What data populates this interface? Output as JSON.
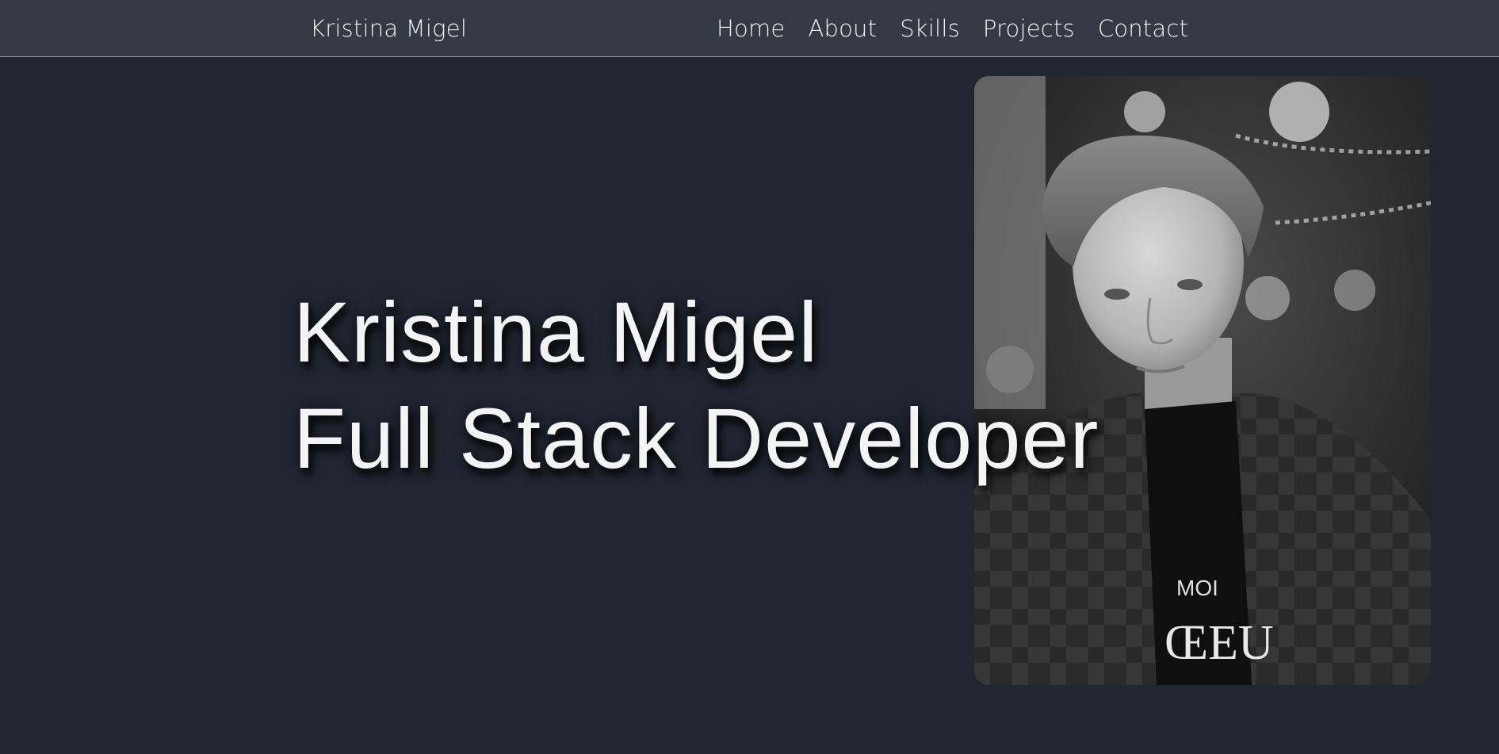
{
  "nav": {
    "brand": "Kristina Migel",
    "links": [
      "Home",
      "About",
      "Skills",
      "Projects",
      "Contact"
    ]
  },
  "hero": {
    "name": "Kristina Migel",
    "role": "Full Stack Developer",
    "photo_shirt_text_top": "MOI",
    "photo_shirt_text_bottom": "ŒEU"
  },
  "colors": {
    "background": "#212631",
    "navbar": "#343a43",
    "accent_border": "#4fb8b0",
    "text": "#f2f2f2"
  }
}
